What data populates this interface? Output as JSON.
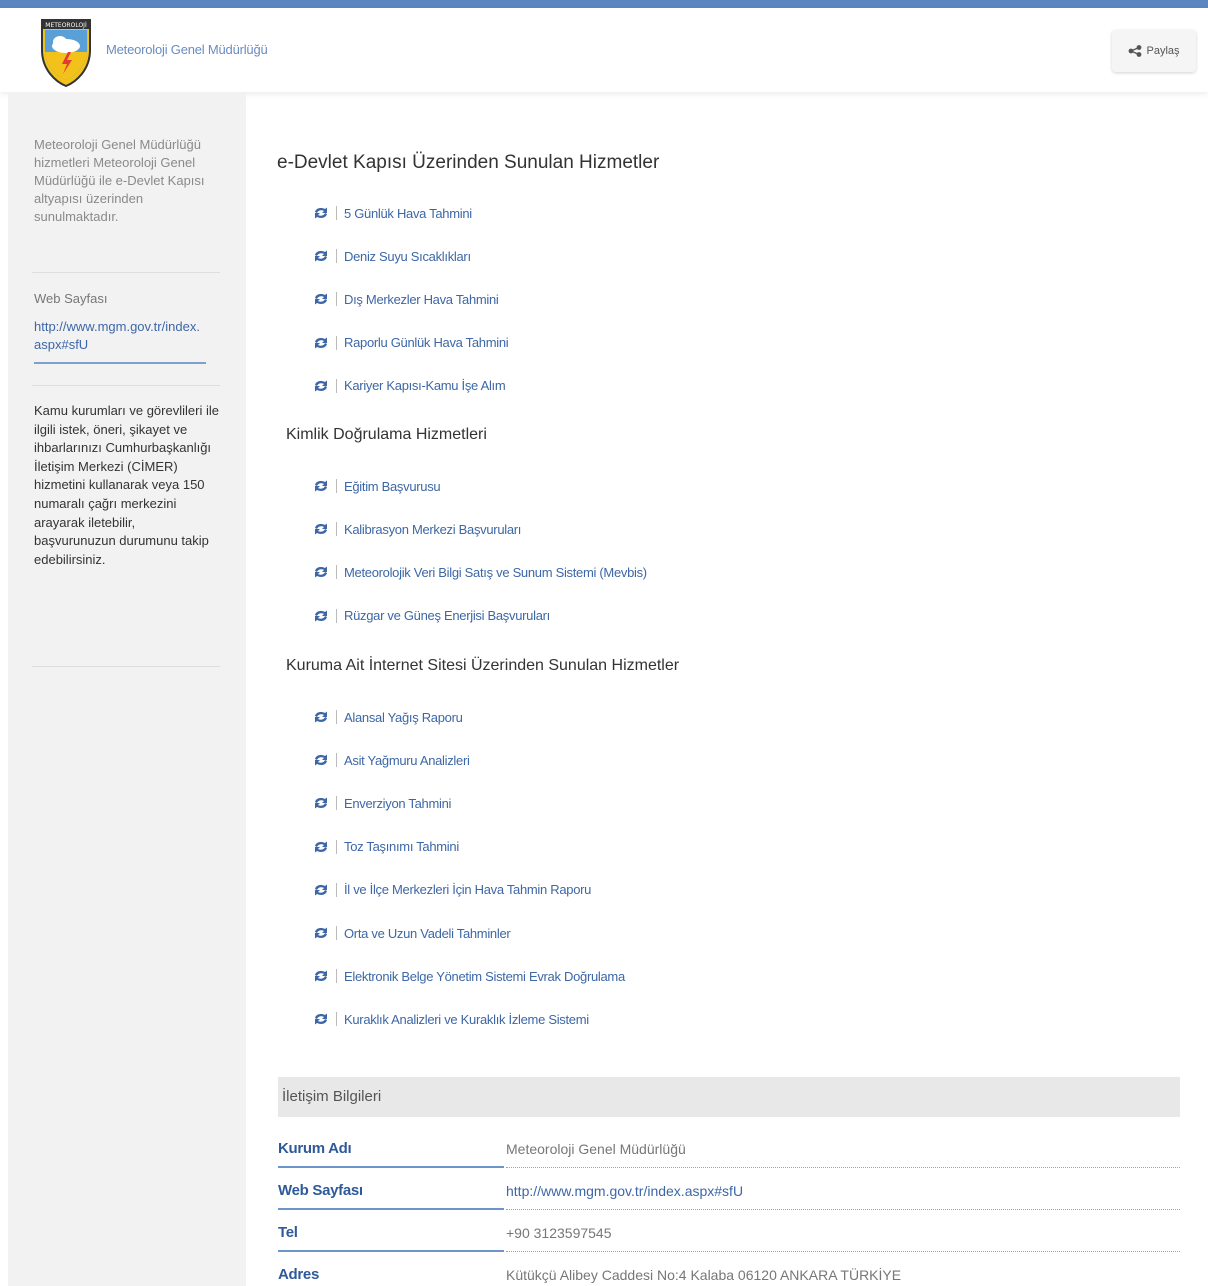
{
  "header": {
    "brand": "Meteoroloji Genel Müdürlüğü",
    "share_label": "Paylaş",
    "logo_text": "METEOROLOJİ"
  },
  "sidebar": {
    "intro": "Meteoroloji Genel Müdürlüğü hizmetleri Meteoroloji Genel Müdürlüğü ile e-Devlet Kapısı altyapısı üzerinden sunulmaktadır.",
    "web_label": "Web Sayfası",
    "web_link": "http://www.mgm.gov.tr/index.aspx#sfU",
    "cimer": "Kamu kurumları ve görevlileri ile ilgili istek, öneri, şikayet ve ihbarlarınızı Cumhurbaşkanlığı İletişim Merkezi (CİMER) hizmetini kullanarak veya 150 numaralı çağrı merkezini arayarak iletebilir, başvurunuzun durumunu takip edebilirsiniz."
  },
  "main": {
    "title": "e-Devlet Kapısı Üzerinden Sunulan Hizmetler",
    "section1": [
      "5 Günlük Hava Tahmini",
      "Deniz Suyu Sıcaklıkları",
      "Dış Merkezler Hava Tahmini",
      "Raporlu Günlük Hava Tahmini",
      "Kariyer Kapısı-Kamu İşe Alım"
    ],
    "section2_title": "Kimlik Doğrulama Hizmetleri",
    "section2": [
      "Eğitim Başvurusu",
      "Kalibrasyon Merkezi Başvuruları",
      "Meteorolojik Veri Bilgi Satış ve Sunum Sistemi (Mevbis)",
      "Rüzgar ve Güneş Enerjisi Başvuruları"
    ],
    "section3_title": "Kuruma Ait İnternet Sitesi Üzerinden Sunulan Hizmetler",
    "section3": [
      "Alansal Yağış Raporu",
      "Asit Yağmuru Analizleri",
      "Enverziyon Tahmini",
      "Toz Taşınımı Tahmini",
      "İl ve İlçe Merkezleri İçin Hava Tahmin Raporu",
      "Orta ve Uzun Vadeli Tahminler",
      "Elektronik Belge Yönetim Sistemi Evrak Doğrulama",
      "Kuraklık Analizleri ve Kuraklık İzleme Sistemi"
    ]
  },
  "contact": {
    "title": "İletişim Bilgileri",
    "rows": [
      {
        "key": "Kurum Adı",
        "value": "Meteoroloji Genel Müdürlüğü"
      },
      {
        "key": "Web Sayfası",
        "value": "http://www.mgm.gov.tr/index.aspx#sfU"
      },
      {
        "key": "Tel",
        "value": "+90 3123597545"
      },
      {
        "key": "Adres",
        "value": "Kütükçü Alibey Caddesi No:4 Kalaba 06120 ANKARA TÜRKİYE"
      }
    ]
  },
  "colors": {
    "accent": "#3d67a6",
    "top_strip": "#5b86bf",
    "sidebar_bg": "#f2f2f2"
  }
}
